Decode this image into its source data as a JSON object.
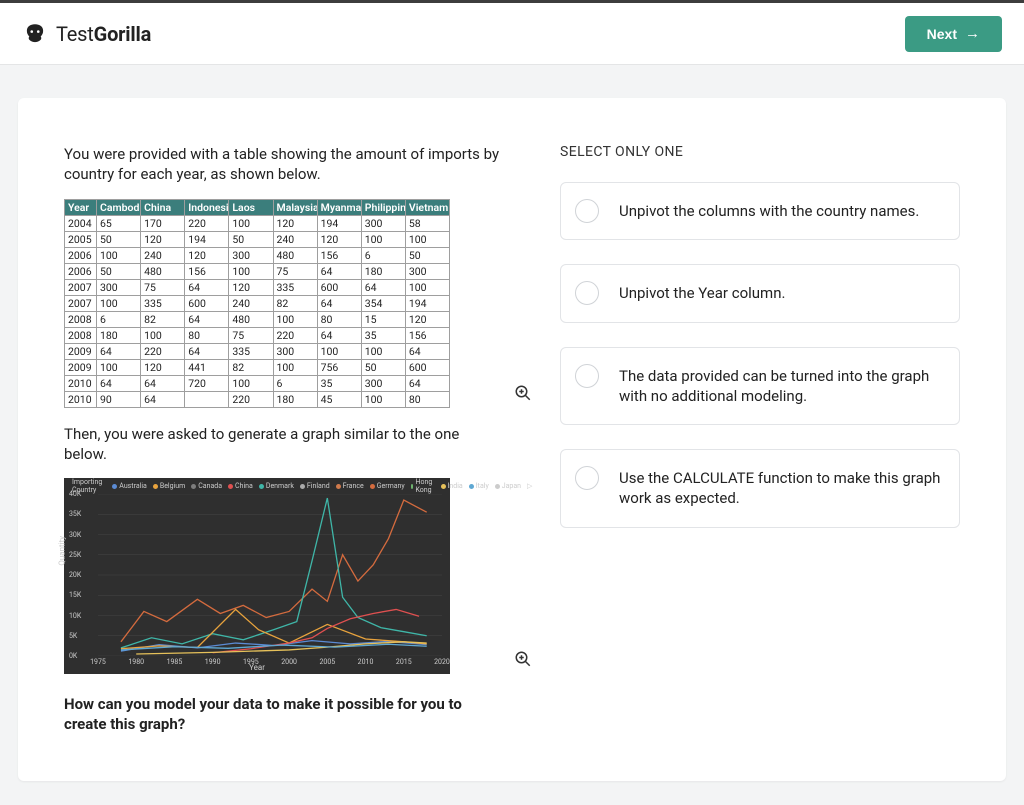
{
  "brand": {
    "name_prefix": "Test",
    "name_bold": "Gorilla"
  },
  "next_button_label": "Next",
  "question": {
    "intro": " You were provided with a table showing the amount of imports by country for each year, as shown below.",
    "after_table": "Then, you were asked to generate a graph similar to the one below.",
    "prompt": "How can you model your data to make it possible for you to create this graph?"
  },
  "table": {
    "headers": [
      "Year",
      "Cambodia",
      "China",
      "Indonesia",
      "Laos",
      "Malaysia",
      "Myanmar",
      "Philippines",
      "Vietnam"
    ],
    "rows": [
      [
        "2004",
        "65",
        "170",
        "220",
        "100",
        "120",
        "194",
        "300",
        "58"
      ],
      [
        "2005",
        "50",
        "120",
        "194",
        "50",
        "240",
        "120",
        "100",
        "100"
      ],
      [
        "2006",
        "100",
        "240",
        "120",
        "300",
        "480",
        "156",
        "6",
        "50"
      ],
      [
        "2006",
        "50",
        "480",
        "156",
        "100",
        "75",
        "64",
        "180",
        "300"
      ],
      [
        "2007",
        "300",
        "75",
        "64",
        "120",
        "335",
        "600",
        "64",
        "100"
      ],
      [
        "2007",
        "100",
        "335",
        "600",
        "240",
        "82",
        "64",
        "354",
        "194"
      ],
      [
        "2008",
        "6",
        "82",
        "64",
        "480",
        "100",
        "80",
        "15",
        "120"
      ],
      [
        "2008",
        "180",
        "100",
        "80",
        "75",
        "220",
        "64",
        "35",
        "156"
      ],
      [
        "2009",
        "64",
        "220",
        "64",
        "335",
        "300",
        "100",
        "100",
        "64"
      ],
      [
        "2009",
        "100",
        "120",
        "441",
        "82",
        "100",
        "756",
        "50",
        "600"
      ],
      [
        "2010",
        "64",
        "64",
        "720",
        "100",
        "6",
        "35",
        "300",
        "64"
      ],
      [
        "2010",
        "90",
        "64",
        "",
        "220",
        "180",
        "45",
        "100",
        "80"
      ]
    ]
  },
  "chart_data": {
    "type": "line",
    "title": "Importing Country",
    "xlabel": "Year",
    "ylabel": "Quantity",
    "xlim": [
      1975,
      2020
    ],
    "ylim": [
      0,
      40000
    ],
    "yticks": [
      0,
      5000,
      10000,
      15000,
      20000,
      25000,
      30000,
      35000,
      40000
    ],
    "ytick_labels": [
      "0K",
      "5K",
      "10K",
      "15K",
      "20K",
      "25K",
      "30K",
      "35K",
      "40K"
    ],
    "xticks": [
      1975,
      1980,
      1985,
      1990,
      1995,
      2000,
      2005,
      2010,
      2015,
      2020
    ],
    "legend": [
      {
        "name": "Australia",
        "color": "#5b8bd4"
      },
      {
        "name": "Belgium",
        "color": "#e8a33d"
      },
      {
        "name": "Canada",
        "color": "#7d7d7d"
      },
      {
        "name": "China",
        "color": "#e05050"
      },
      {
        "name": "Denmark",
        "color": "#3fb6a8"
      },
      {
        "name": "Finland",
        "color": "#aaaaaa"
      },
      {
        "name": "France",
        "color": "#d07a4c"
      },
      {
        "name": "Germany",
        "color": "#d46b3e"
      },
      {
        "name": "Hong Kong",
        "color": "#6fb56f"
      },
      {
        "name": "India",
        "color": "#e6c15a"
      },
      {
        "name": "Italy",
        "color": "#5fa8d3"
      },
      {
        "name": "Japan",
        "color": "#cccccc"
      }
    ],
    "series": [
      {
        "name": "Germany",
        "color": "#d46b3e",
        "points": [
          [
            1978,
            3500
          ],
          [
            1981,
            11000
          ],
          [
            1984,
            8500
          ],
          [
            1988,
            14000
          ],
          [
            1991,
            10500
          ],
          [
            1994,
            12500
          ],
          [
            1997,
            9500
          ],
          [
            2000,
            11000
          ],
          [
            2003,
            16500
          ],
          [
            2005,
            13500
          ],
          [
            2007,
            25000
          ],
          [
            2009,
            18500
          ],
          [
            2011,
            22500
          ],
          [
            2013,
            29000
          ],
          [
            2015,
            38500
          ],
          [
            2018,
            35500
          ]
        ]
      },
      {
        "name": "Denmark",
        "color": "#3fb6a8",
        "points": [
          [
            1978,
            2000
          ],
          [
            1982,
            4500
          ],
          [
            1986,
            3000
          ],
          [
            1990,
            5500
          ],
          [
            1994,
            4000
          ],
          [
            1998,
            6500
          ],
          [
            2001,
            8500
          ],
          [
            2003,
            23500
          ],
          [
            2005,
            39000
          ],
          [
            2007,
            14500
          ],
          [
            2009,
            9500
          ],
          [
            2012,
            7000
          ],
          [
            2015,
            6000
          ],
          [
            2018,
            5000
          ]
        ]
      },
      {
        "name": "Australia",
        "color": "#5b8bd4",
        "points": [
          [
            1978,
            1200
          ],
          [
            1983,
            2800
          ],
          [
            1988,
            2000
          ],
          [
            1993,
            3200
          ],
          [
            1998,
            2600
          ],
          [
            2003,
            3800
          ],
          [
            2008,
            3000
          ],
          [
            2013,
            3600
          ],
          [
            2018,
            2800
          ]
        ]
      },
      {
        "name": "Belgium",
        "color": "#e8a33d",
        "points": [
          [
            1978,
            1800
          ],
          [
            1983,
            2500
          ],
          [
            1988,
            2100
          ],
          [
            1993,
            11500
          ],
          [
            1996,
            6500
          ],
          [
            2000,
            3200
          ],
          [
            2005,
            7800
          ],
          [
            2010,
            4200
          ],
          [
            2015,
            3500
          ],
          [
            2018,
            3000
          ]
        ]
      },
      {
        "name": "China",
        "color": "#e05050",
        "points": [
          [
            1990,
            800
          ],
          [
            1995,
            1800
          ],
          [
            2000,
            3200
          ],
          [
            2003,
            4500
          ],
          [
            2005,
            6800
          ],
          [
            2008,
            9200
          ],
          [
            2011,
            10500
          ],
          [
            2014,
            11500
          ],
          [
            2017,
            9800
          ]
        ]
      },
      {
        "name": "India",
        "color": "#e6c15a",
        "points": [
          [
            1980,
            500
          ],
          [
            1990,
            900
          ],
          [
            2000,
            1500
          ],
          [
            2005,
            2200
          ],
          [
            2010,
            3000
          ],
          [
            2015,
            3500
          ],
          [
            2018,
            3200
          ]
        ]
      },
      {
        "name": "Italy",
        "color": "#5fa8d3",
        "points": [
          [
            1978,
            1500
          ],
          [
            1985,
            2300
          ],
          [
            1992,
            1900
          ],
          [
            1999,
            2700
          ],
          [
            2006,
            2200
          ],
          [
            2013,
            2900
          ],
          [
            2018,
            2400
          ]
        ]
      }
    ]
  },
  "answer_instruction": "SELECT ONLY ONE",
  "options": [
    "Unpivot the columns with the country names.",
    "Unpivot the Year column.",
    "The data provided can be turned into the graph with no additional modeling.",
    "Use the CALCULATE function to make this graph work as expected."
  ]
}
